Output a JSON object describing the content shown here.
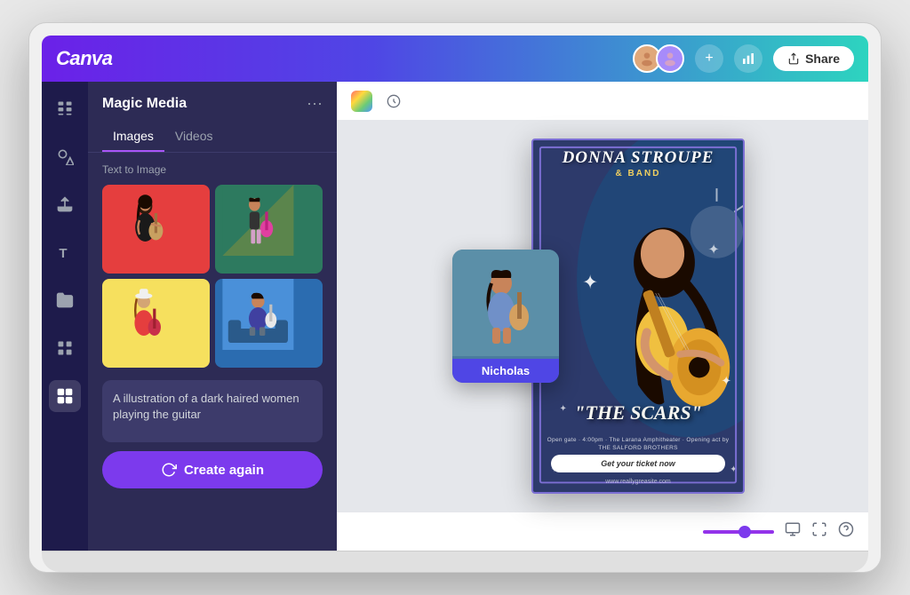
{
  "app": {
    "name": "Canva"
  },
  "header": {
    "logo": "Canva",
    "share_label": "Share",
    "plus_label": "+"
  },
  "panel": {
    "title": "Magic Media",
    "more_label": "···",
    "tabs": [
      {
        "id": "images",
        "label": "Images",
        "active": true
      },
      {
        "id": "videos",
        "label": "Videos",
        "active": false
      }
    ],
    "section_label": "Text to Image",
    "prompt_text": "A illustration of a dark haired women playing the guitar",
    "create_again_label": "Create again"
  },
  "poster": {
    "title": "DONNA STROUPE",
    "subtitle": "& BAND",
    "big_title": "\"THE SCARS\"",
    "details": "Open gate · 4:00pm · The Larana Amphitheater · Opening act by THE SALFORD BROTHERS",
    "ticket_btn": "Get your ticket now",
    "website": "www.reallygreasite.com"
  },
  "floating_card": {
    "user_label": "Nicholas"
  },
  "toolbar": {
    "zoom_level": "100%"
  }
}
